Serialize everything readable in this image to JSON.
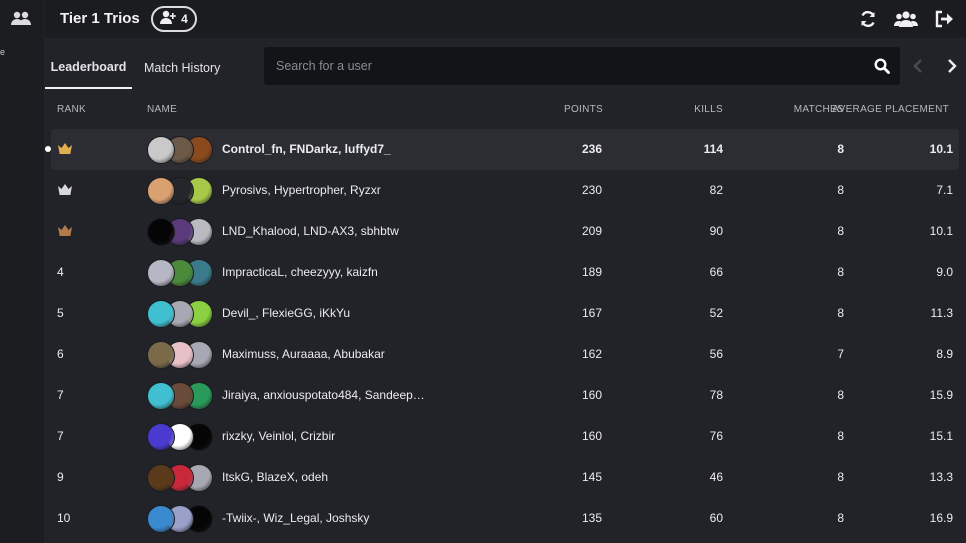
{
  "topbar": {
    "title": "Tier 1 Trios",
    "team_count": "4"
  },
  "tabs": [
    {
      "label": "Leaderboard"
    },
    {
      "label": "Match History"
    }
  ],
  "search": {
    "placeholder": "Search for a user",
    "value": ""
  },
  "columns": {
    "rank": "RANK",
    "name": "NAME",
    "points": "POINTS",
    "kills": "KILLS",
    "matches": "MATCHES",
    "avg": "AVERAGE PLACEMENT"
  },
  "colors": {
    "gold_crown": "#e0b050",
    "silver_crown": "#d8d8dc",
    "bronze_crown": "#b27a4a",
    "background": "#222328"
  },
  "rows": [
    {
      "rank": "",
      "medal": "gold",
      "names": "Control_fn, FNDarkz, luffyd7_",
      "points": "236",
      "kills": "114",
      "matches": "8",
      "avg": "10.1"
    },
    {
      "rank": "",
      "medal": "silver",
      "names": "Pyrosivs, Hypertropher, Ryzxr",
      "points": "230",
      "kills": "82",
      "matches": "8",
      "avg": "7.1"
    },
    {
      "rank": "",
      "medal": "bronze",
      "names": "LND_Khalood, LND-AX3, sbhbtw",
      "points": "209",
      "kills": "90",
      "matches": "8",
      "avg": "10.1"
    },
    {
      "rank": "4",
      "medal": "",
      "names": "ImpracticaL, cheezyyy, kaizfn",
      "points": "189",
      "kills": "66",
      "matches": "8",
      "avg": "9.0"
    },
    {
      "rank": "5",
      "medal": "",
      "names": "Devil_, FlexieGG, iKkYu",
      "points": "167",
      "kills": "52",
      "matches": "8",
      "avg": "11.3"
    },
    {
      "rank": "6",
      "medal": "",
      "names": "Maximuss, Auraaaa, Abubakar",
      "points": "162",
      "kills": "56",
      "matches": "7",
      "avg": "8.9"
    },
    {
      "rank": "7",
      "medal": "",
      "names": "Jiraiya, anxiouspotato484, Sandeep…",
      "points": "160",
      "kills": "78",
      "matches": "8",
      "avg": "15.9"
    },
    {
      "rank": "7",
      "medal": "",
      "names": "rixzky, Veinlol, Crizbir",
      "points": "160",
      "kills": "76",
      "matches": "8",
      "avg": "15.1"
    },
    {
      "rank": "9",
      "medal": "",
      "names": "ItskG, BlazeX, odeh",
      "points": "145",
      "kills": "46",
      "matches": "8",
      "avg": "13.3"
    },
    {
      "rank": "10",
      "medal": "",
      "names": "-Twiix-, Wiz_Legal, Joshsky",
      "points": "135",
      "kills": "60",
      "matches": "8",
      "avg": "16.9"
    }
  ],
  "icons": {
    "sidebar": "users-icon",
    "team": "user-group-icon",
    "refresh": "refresh-icon",
    "friends": "users-icon",
    "logout": "logout-icon",
    "search": "search-icon",
    "prev": "chevron-left-icon",
    "next": "chevron-right-icon"
  }
}
